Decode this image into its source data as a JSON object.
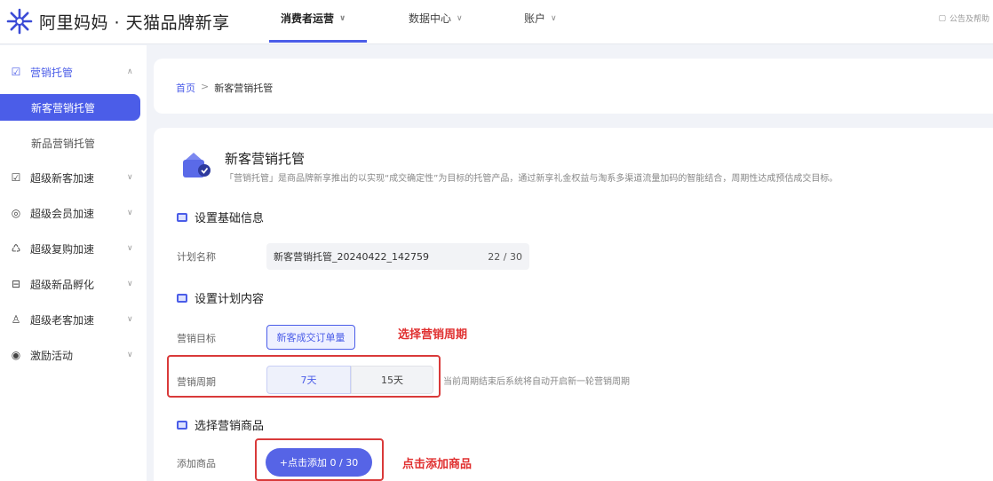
{
  "header": {
    "brand": "阿里妈妈 · 天猫品牌新享",
    "nav": [
      {
        "label": "消费者运营",
        "active": true
      },
      {
        "label": "数据中心",
        "active": false
      },
      {
        "label": "账户",
        "active": false
      }
    ],
    "right_text": "公告及帮助"
  },
  "sidebar": {
    "groups": [
      {
        "label": "营销托管",
        "icon": "marketing-icon",
        "open": true,
        "children": [
          {
            "label": "新客营销托管",
            "active": true
          },
          {
            "label": "新品营销托管",
            "active": false
          }
        ]
      },
      {
        "label": "超级新客加速",
        "icon": "new-customer-icon"
      },
      {
        "label": "超级会员加速",
        "icon": "member-icon"
      },
      {
        "label": "超级复购加速",
        "icon": "repurchase-icon"
      },
      {
        "label": "超级新品孵化",
        "icon": "incubate-icon"
      },
      {
        "label": "超级老客加速",
        "icon": "old-customer-icon"
      },
      {
        "label": "激励活动",
        "icon": "incentive-icon"
      }
    ]
  },
  "breadcrumb": {
    "home": "首页",
    "separator": ">",
    "current": "新客营销托管"
  },
  "page": {
    "title": "新客营销托管",
    "description": "「营销托管」是商品牌新享推出的以实现“成交确定性”为目标的托管产品，通过新享礼金权益与淘系多渠道流量加码的智能结合，周期性达成预估成交目标。"
  },
  "sections": {
    "basic": {
      "title": "设置基础信息",
      "plan_name_label": "计划名称",
      "plan_name_value": "新客营销托管_20240422_142759",
      "plan_name_count": "22 / 30"
    },
    "plan": {
      "title": "设置计划内容",
      "goal_label": "营销目标",
      "goal_value": "新客成交订单量",
      "cycle_label": "营销周期",
      "cycle_options": [
        "7天",
        "15天"
      ],
      "cycle_selected": "7天",
      "cycle_hint": "当前周期结束后系统将自动开启新一轮营销周期"
    },
    "goods": {
      "title": "选择营销商品",
      "add_label": "添加商品",
      "add_button": "+点击添加 0 / 30"
    }
  },
  "annotations": {
    "cycle_note": "选择营销周期",
    "goods_note": "点击添加商品",
    "color": "#e03030"
  },
  "colors": {
    "accent": "#4b5de8",
    "button": "#5664e6"
  }
}
